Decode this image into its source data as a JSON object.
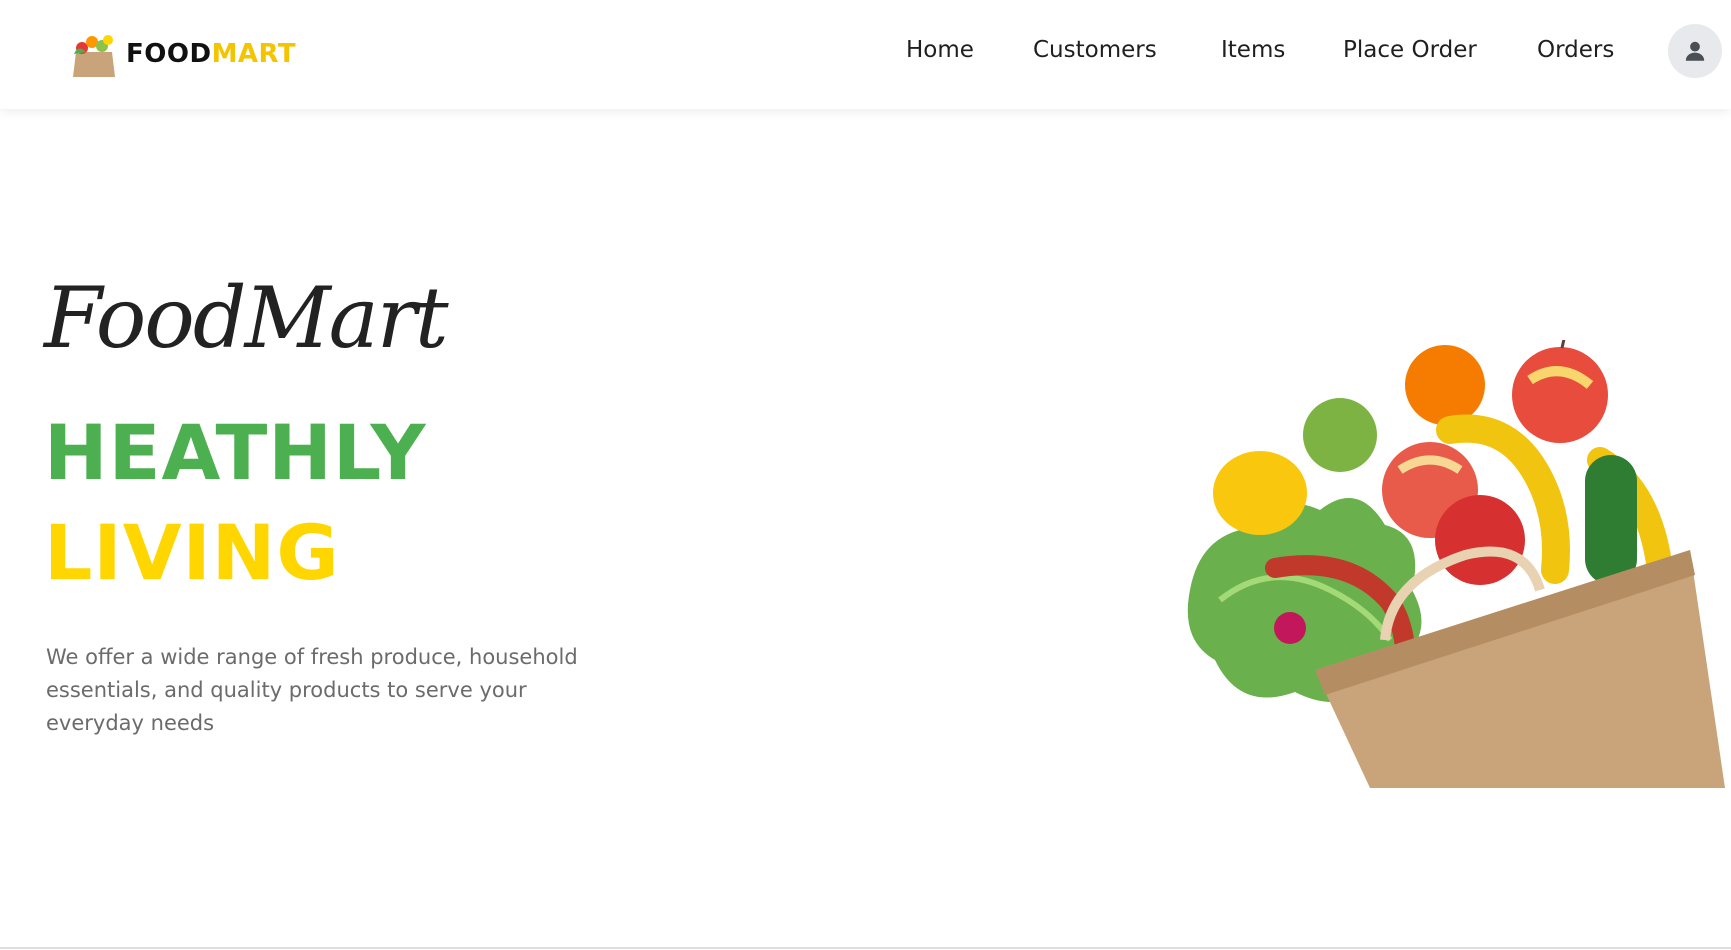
{
  "brand": {
    "name_primary": "FOOD",
    "name_accent": "MART",
    "logo_icon": "grocery-bag-icon"
  },
  "nav": {
    "items": [
      {
        "label": "Home"
      },
      {
        "label": "Customers"
      },
      {
        "label": "Items"
      },
      {
        "label": "Place Order"
      },
      {
        "label": "Orders"
      }
    ],
    "profile_icon": "user-icon"
  },
  "hero": {
    "script_title": "FoodMart",
    "headline_line1": "HEATHLY",
    "headline_line2": "LIVING",
    "description": "We offer a wide range of fresh produce, household essentials, and quality products to serve your everyday needs",
    "image": "grocery-bag-produce-icon"
  },
  "colors": {
    "accent_yellow": "#ffd600",
    "accent_green": "#4caf50",
    "text_dark": "#1f1f1f",
    "text_muted": "#6b6b6b"
  }
}
